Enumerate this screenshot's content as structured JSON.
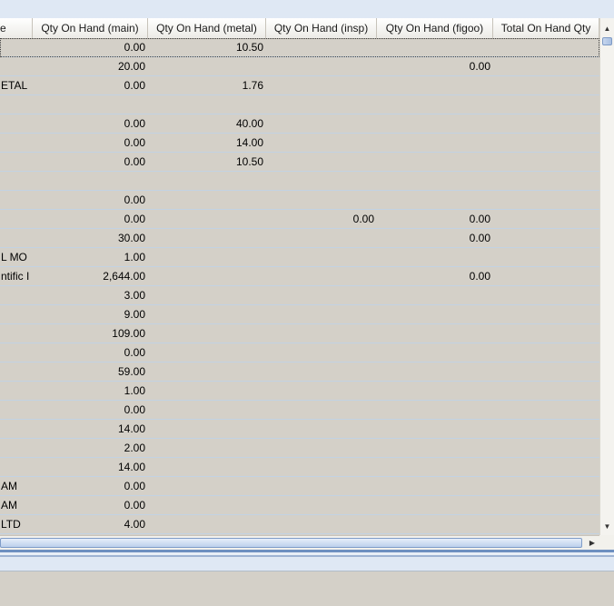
{
  "grid": {
    "columns": [
      {
        "key": "name",
        "label": "e"
      },
      {
        "key": "main",
        "label": "Qty On Hand (main)"
      },
      {
        "key": "metal",
        "label": "Qty On Hand (metal)"
      },
      {
        "key": "insp",
        "label": "Qty On Hand (insp)"
      },
      {
        "key": "figoo",
        "label": "Qty On Hand (figoo)"
      },
      {
        "key": "total",
        "label": "Total On Hand Qty"
      }
    ],
    "rows": [
      {
        "name": "",
        "main": "0.00",
        "metal": "10.50",
        "insp": "",
        "figoo": "",
        "total": ""
      },
      {
        "name": "",
        "main": "20.00",
        "metal": "",
        "insp": "",
        "figoo": "0.00",
        "total": ""
      },
      {
        "name": "ETAL",
        "main": "0.00",
        "metal": "1.76",
        "insp": "",
        "figoo": "",
        "total": ""
      },
      {
        "name": "",
        "main": "",
        "metal": "",
        "insp": "",
        "figoo": "",
        "total": ""
      },
      {
        "name": "",
        "main": "0.00",
        "metal": "40.00",
        "insp": "",
        "figoo": "",
        "total": ""
      },
      {
        "name": "",
        "main": "0.00",
        "metal": "14.00",
        "insp": "",
        "figoo": "",
        "total": ""
      },
      {
        "name": "",
        "main": "0.00",
        "metal": "10.50",
        "insp": "",
        "figoo": "",
        "total": ""
      },
      {
        "name": "",
        "main": "",
        "metal": "",
        "insp": "",
        "figoo": "",
        "total": ""
      },
      {
        "name": "",
        "main": "0.00",
        "metal": "",
        "insp": "",
        "figoo": "",
        "total": ""
      },
      {
        "name": "",
        "main": "0.00",
        "metal": "",
        "insp": "0.00",
        "figoo": "0.00",
        "total": ""
      },
      {
        "name": "",
        "main": "30.00",
        "metal": "",
        "insp": "",
        "figoo": "0.00",
        "total": ""
      },
      {
        "name": "L MO",
        "main": "1.00",
        "metal": "",
        "insp": "",
        "figoo": "",
        "total": ""
      },
      {
        "name": "ntific I",
        "main": "2,644.00",
        "metal": "",
        "insp": "",
        "figoo": "0.00",
        "total": ""
      },
      {
        "name": "",
        "main": "3.00",
        "metal": "",
        "insp": "",
        "figoo": "",
        "total": ""
      },
      {
        "name": "",
        "main": "9.00",
        "metal": "",
        "insp": "",
        "figoo": "",
        "total": ""
      },
      {
        "name": "",
        "main": "109.00",
        "metal": "",
        "insp": "",
        "figoo": "",
        "total": ""
      },
      {
        "name": "",
        "main": "0.00",
        "metal": "",
        "insp": "",
        "figoo": "",
        "total": ""
      },
      {
        "name": "",
        "main": "59.00",
        "metal": "",
        "insp": "",
        "figoo": "",
        "total": ""
      },
      {
        "name": "",
        "main": "1.00",
        "metal": "",
        "insp": "",
        "figoo": "",
        "total": ""
      },
      {
        "name": "",
        "main": "0.00",
        "metal": "",
        "insp": "",
        "figoo": "",
        "total": ""
      },
      {
        "name": "",
        "main": "14.00",
        "metal": "",
        "insp": "",
        "figoo": "",
        "total": ""
      },
      {
        "name": "",
        "main": "2.00",
        "metal": "",
        "insp": "",
        "figoo": "",
        "total": ""
      },
      {
        "name": "",
        "main": "14.00",
        "metal": "",
        "insp": "",
        "figoo": "",
        "total": ""
      },
      {
        "name": "AM",
        "main": "0.00",
        "metal": "",
        "insp": "",
        "figoo": "",
        "total": ""
      },
      {
        "name": "AM",
        "main": "0.00",
        "metal": "",
        "insp": "",
        "figoo": "",
        "total": ""
      },
      {
        "name": "LTD",
        "main": "4.00",
        "metal": "",
        "insp": "",
        "figoo": "",
        "total": ""
      }
    ]
  },
  "scrollbars": {
    "up_icon": "arrow-up-icon",
    "down_icon": "arrow-down-icon",
    "right_icon": "arrow-right-icon"
  },
  "colors": {
    "grid_bg": "#d4d0c8",
    "row_line": "#c2d2e3",
    "header_bg": "#ecebe6",
    "splitter": "#6d8fc0"
  }
}
